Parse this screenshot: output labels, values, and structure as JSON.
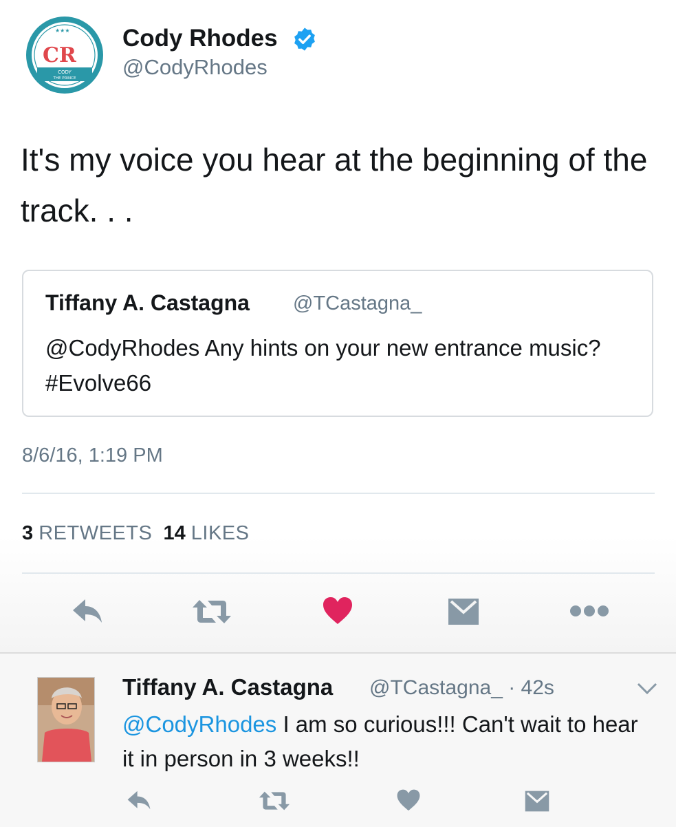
{
  "tweet": {
    "author_name": "Cody Rhodes",
    "author_handle": "@CodyRhodes",
    "avatar_text": {
      "top": "CODY",
      "bottom": "THE PRINCE"
    },
    "text": "It's my voice you hear at the beginning of the track. . .",
    "quoted": {
      "name": "Tiffany A. Castagna",
      "handle": "@TCastagna_",
      "text": "@CodyRhodes Any hints on your new entrance music? #Evolve66"
    },
    "timestamp": "8/6/16, 1:19 PM",
    "stats": {
      "retweets_count": "3",
      "retweets_label": "RETWEETS",
      "likes_count": "14",
      "likes_label": "LIKES"
    },
    "actions": [
      {
        "name": "reply",
        "icon": "reply-icon"
      },
      {
        "name": "retweet",
        "icon": "retweet-icon"
      },
      {
        "name": "like",
        "icon": "heart-icon",
        "active": true
      },
      {
        "name": "message",
        "icon": "envelope-icon"
      },
      {
        "name": "more",
        "icon": "more-icon"
      }
    ]
  },
  "reply": {
    "name": "Tiffany A. Castagna",
    "handle_time": "@TCastagna_ · 42s",
    "mention": "@CodyRhodes",
    "text": " I am so curious!!! Can't wait to hear it in person in 3 weeks!!",
    "actions": [
      {
        "name": "reply",
        "icon": "reply-icon"
      },
      {
        "name": "retweet",
        "icon": "retweet-icon"
      },
      {
        "name": "like",
        "icon": "heart-icon",
        "active": false
      },
      {
        "name": "message",
        "icon": "envelope-icon"
      }
    ]
  },
  "colors": {
    "link_blue": "#1b95e0",
    "secondary_text": "#657786",
    "like_red": "#e0245e",
    "verified_blue": "#1da1f2",
    "icon_gray": "#8899a6",
    "logo_teal": "#2a98a8",
    "logo_red": "#e0474c"
  }
}
